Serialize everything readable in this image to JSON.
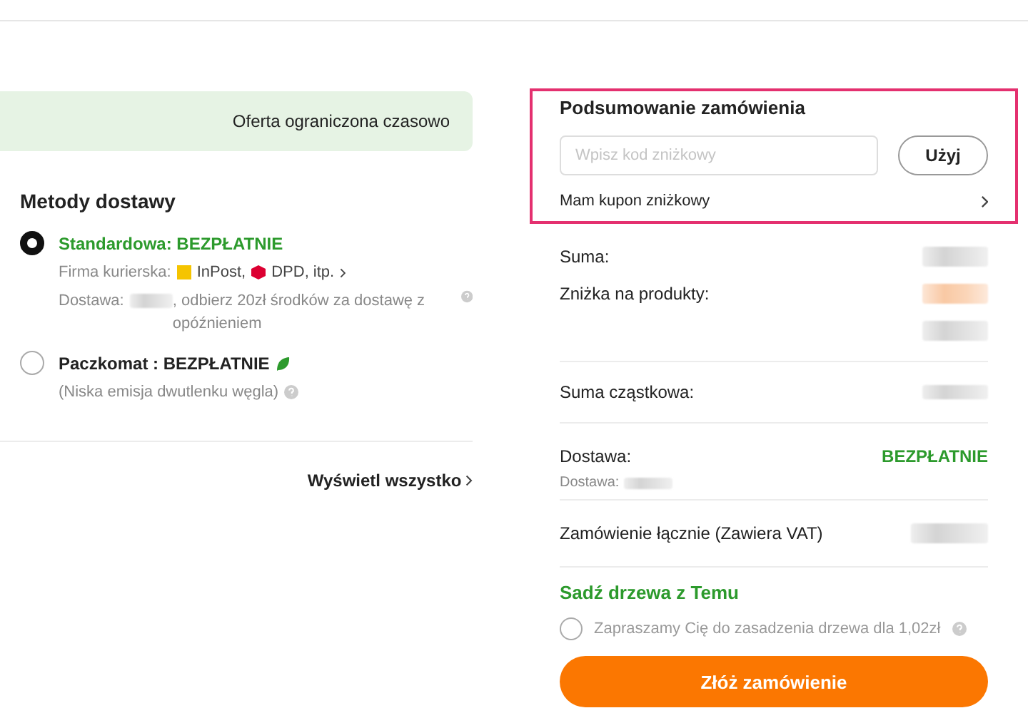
{
  "banner": {
    "text": "Oferta ograniczona czasowo"
  },
  "delivery": {
    "title": "Metody dostawy",
    "options": [
      {
        "kind": "standard",
        "selected": true,
        "label": "Standardowa: BEZPŁATNIE",
        "carrier_label": "Firma kurierska:",
        "carriers": [
          "InPost,",
          "DPD, itp."
        ],
        "eta_prefix": "Dostawa:",
        "eta_suffix": ", odbierz 20zł środków za dostawę z opóźnieniem"
      },
      {
        "kind": "locker",
        "selected": false,
        "label": "Paczkomat : BEZPŁATNIE",
        "note": "(Niska emisja dwutlenku węgla)"
      }
    ],
    "view_all": "Wyświetl wszystko"
  },
  "summary": {
    "title": "Podsumowanie zamówienia",
    "coupon_field": {
      "placeholder": "Wpisz kod zniżkowy"
    },
    "apply_button": "Użyj",
    "coupon_link": "Mam kupon zniżkowy",
    "rows": [
      {
        "label": "Suma:",
        "kind": "grey"
      },
      {
        "label": "Zniżka na produkty:",
        "kind": "orange"
      },
      {
        "label": "",
        "kind": "grey"
      }
    ],
    "subtotal": {
      "label": "Suma cząstkowa:"
    },
    "shipping": {
      "label": "Dostawa:",
      "value": "BEZPŁATNIE",
      "sub_label": "Dostawa:"
    },
    "total": {
      "label": "Zamówienie łącznie (Zawiera VAT)"
    },
    "trees": {
      "title": "Sadź drzewa z Temu",
      "option": {
        "label": "Zapraszamy Cię do zasadzenia drzewa dla 1,02zł",
        "checked": false
      }
    },
    "order_button": "Złóż zamówienie"
  }
}
